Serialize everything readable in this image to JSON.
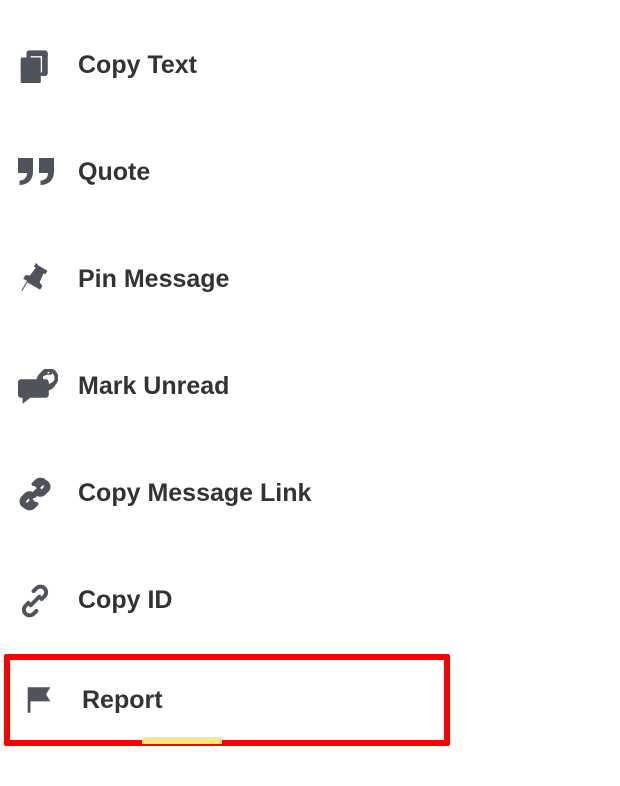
{
  "menu": {
    "items": [
      {
        "label": "Copy Text"
      },
      {
        "label": "Quote"
      },
      {
        "label": "Pin Message"
      },
      {
        "label": "Mark Unread"
      },
      {
        "label": "Copy Message Link"
      },
      {
        "label": "Copy ID"
      },
      {
        "label": "Report"
      }
    ]
  },
  "colors": {
    "icon": "#4f545c",
    "text": "#343333",
    "highlight_border": "#ff0000",
    "underline": "#ffe97a"
  }
}
